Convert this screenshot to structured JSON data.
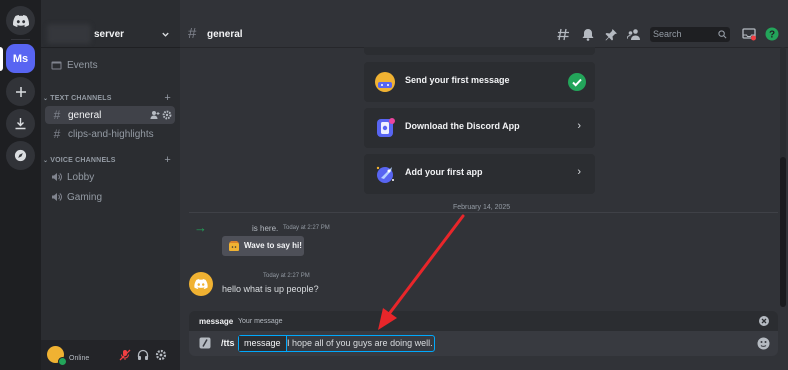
{
  "rail": {
    "home_icon": "discord-logo-icon",
    "active_server_initials": "Ms",
    "add_icon": "plus-icon",
    "download_icon": "download-icon",
    "explore_icon": "compass-icon"
  },
  "sidebar": {
    "server_name": "server",
    "events_label": "Events",
    "text_category": "TEXT CHANNELS",
    "voice_category": "VOICE CHANNELS",
    "text_channels": [
      {
        "name": "general",
        "active": true
      },
      {
        "name": "clips-and-highlights",
        "active": false
      }
    ],
    "voice_channels": [
      {
        "name": "Lobby"
      },
      {
        "name": "Gaming"
      }
    ]
  },
  "user_panel": {
    "status": "Online"
  },
  "header": {
    "channel_name": "general",
    "search_placeholder": "Search"
  },
  "onboarding": {
    "items": [
      {
        "label": "Send your first message",
        "done": true
      },
      {
        "label": "Download the Discord App",
        "done": false
      },
      {
        "label": "Add your first app",
        "done": false
      }
    ]
  },
  "messages": {
    "date_divider": "February 14, 2025",
    "join_text": "is here.",
    "join_time": "Today at 2:27 PM",
    "wave_label": "Wave to say hi!",
    "msg_time": "Today at 2:27 PM",
    "msg_text": "hello what is up people?"
  },
  "command": {
    "option_name": "message",
    "option_desc": "Your message",
    "slash": "/tts",
    "chip_label": "message",
    "value": "I hope all of you guys are doing well."
  },
  "colors": {
    "accent": "#5865f2",
    "success": "#23a55a",
    "annotation_arrow": "#e8262a"
  }
}
